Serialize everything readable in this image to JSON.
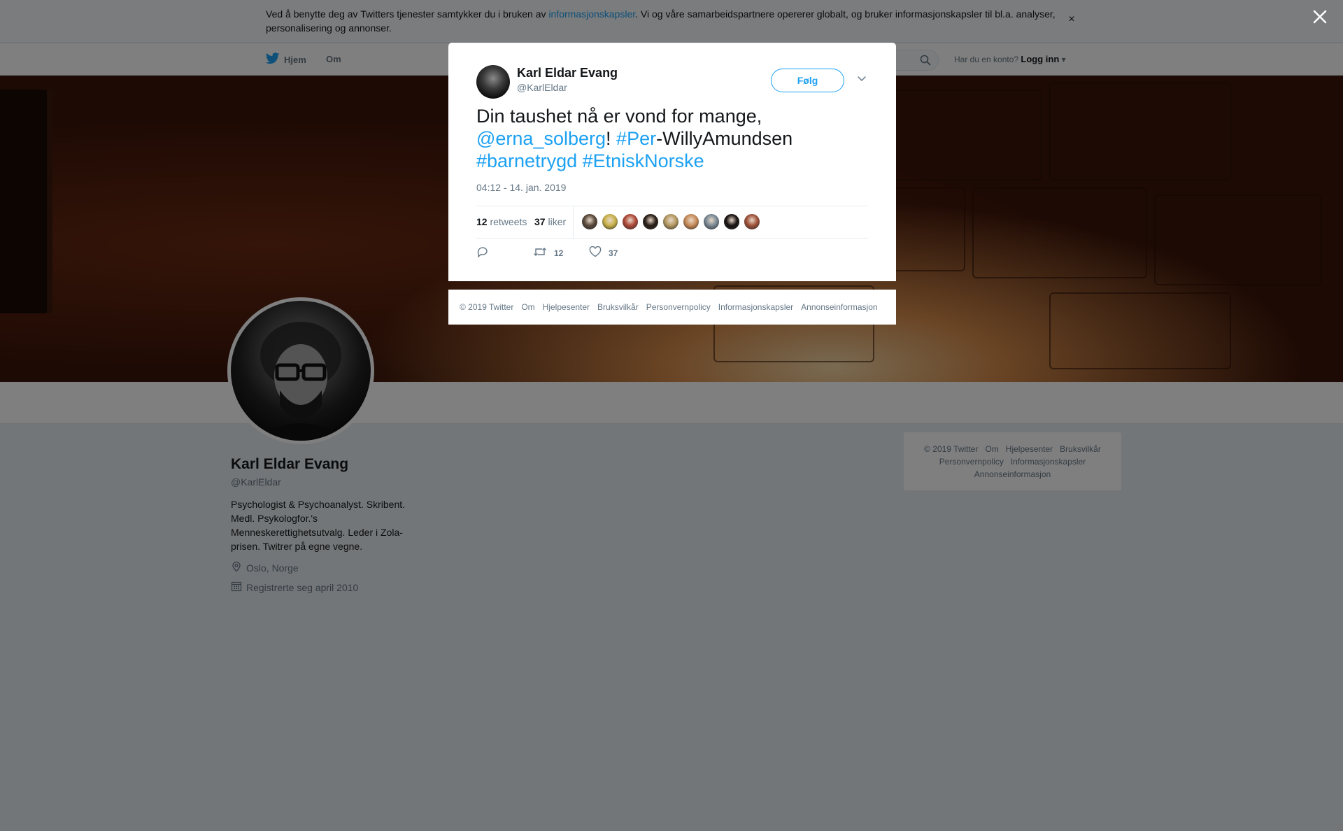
{
  "cookie_banner": {
    "text_before": "Ved å benytte deg av Twitters tjenester samtykker du i bruken av ",
    "link": "informasjonskapsler",
    "text_after": ". Vi og våre samarbeidspartnere opererer globalt, og bruker informasjonskapsler til bl.a. analyser, personalisering og annonser.",
    "close": "×"
  },
  "nav": {
    "home": "Hjem",
    "about": "Om",
    "has_account": "Har du en konto?",
    "login": "Logg inn"
  },
  "profile": {
    "name": "Karl Eldar Evang",
    "handle": "@KarlEldar",
    "bio": "Psychologist & Psychoanalyst. Skribent. Medl. Psykologfor.'s Menneskerettighetsutvalg. Leder i Zola-prisen. Twitrer på egne vegne.",
    "location": "Oslo, Norge",
    "joined": "Registrerte seg april 2010"
  },
  "side_footer": {
    "line1": [
      "© 2019 Twitter",
      "Om",
      "Hjelpesenter",
      "Bruksvilkår"
    ],
    "line2": [
      "Personvernpolicy",
      "Informasjonskapsler"
    ],
    "line3": [
      "Annonseinformasjon"
    ]
  },
  "tweet": {
    "author_name": "Karl Eldar Evang",
    "author_handle": "@KarlEldar",
    "follow": "Følg",
    "text_1": "Din taushet nå er vond for mange, ",
    "mention": "@erna_solberg",
    "text_2": "! ",
    "hashtag_per": "#Per",
    "text_3": "-WillyAmundsen ",
    "hashtag_1": "#barnetrygd",
    "text_4": " ",
    "hashtag_2": "#EtniskNorske",
    "timestamp": "04:12 - 14. jan. 2019",
    "retweets_count": "12",
    "retweets_label": "retweets",
    "likes_count": "37",
    "likes_label": "liker",
    "action_retweets": "12",
    "action_likes": "37",
    "liker_colors": [
      "#5a4a3c",
      "#c9b24a",
      "#b04a3a",
      "#2b2018",
      "#b59a62",
      "#c88c5a",
      "#7a8a96",
      "#1a1414",
      "#a0523a"
    ]
  },
  "modal_footer": [
    "© 2019 Twitter",
    "Om",
    "Hjelpesenter",
    "Bruksvilkår",
    "Personvernpolicy",
    "Informasjonskapsler",
    "Annonseinformasjon"
  ],
  "colors": {
    "accent": "#1da1f2",
    "secondary_text": "#657786"
  }
}
